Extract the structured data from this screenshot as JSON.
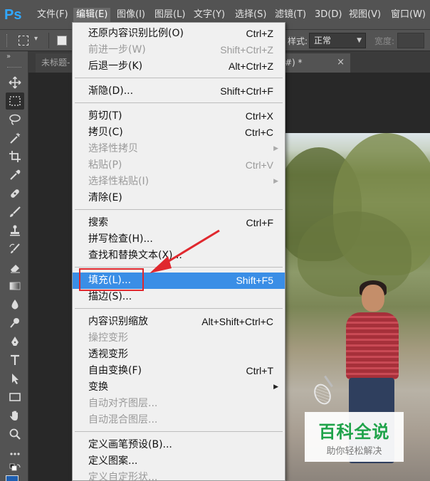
{
  "app": {
    "logo": "Ps"
  },
  "menubar": {
    "items": [
      {
        "label": "文件(F)"
      },
      {
        "label": "编辑(E)"
      },
      {
        "label": "图像(I)"
      },
      {
        "label": "图层(L)"
      },
      {
        "label": "文字(Y)"
      },
      {
        "label": "选择(S)"
      },
      {
        "label": "滤镜(T)"
      },
      {
        "label": "3D(D)"
      },
      {
        "label": "视图(V)"
      },
      {
        "label": "窗口(W)"
      }
    ]
  },
  "options": {
    "style_label": "样式:",
    "style_value": "正常",
    "width_label": "宽度:"
  },
  "tabs": {
    "inactive_label": "未标题-",
    "active_label": "#) *",
    "close": "×"
  },
  "edit_menu": {
    "items": [
      {
        "label": "还原内容识别比例(O)",
        "shortcut": "Ctrl+Z"
      },
      {
        "label": "前进一步(W)",
        "shortcut": "Shift+Ctrl+Z",
        "disabled": true
      },
      {
        "label": "后退一步(K)",
        "shortcut": "Alt+Ctrl+Z"
      },
      {
        "label": "渐隐(D)...",
        "shortcut": "Shift+Ctrl+F"
      },
      {
        "label": "剪切(T)",
        "shortcut": "Ctrl+X"
      },
      {
        "label": "拷贝(C)",
        "shortcut": "Ctrl+C"
      },
      {
        "label": "选择性拷贝",
        "shortcut": "",
        "disabled": true,
        "submenu": true
      },
      {
        "label": "粘贴(P)",
        "shortcut": "Ctrl+V",
        "disabled": true
      },
      {
        "label": "选择性粘贴(I)",
        "shortcut": "",
        "disabled": true,
        "submenu": true
      },
      {
        "label": "清除(E)",
        "shortcut": ""
      },
      {
        "label": "搜索",
        "shortcut": "Ctrl+F"
      },
      {
        "label": "拼写检查(H)...",
        "shortcut": ""
      },
      {
        "label": "查找和替换文本(X)...",
        "shortcut": ""
      },
      {
        "label": "填充(L)...",
        "shortcut": "Shift+F5",
        "highlighted": true
      },
      {
        "label": "描边(S)...",
        "shortcut": ""
      },
      {
        "label": "内容识别缩放",
        "shortcut": "Alt+Shift+Ctrl+C"
      },
      {
        "label": "操控变形",
        "shortcut": "",
        "disabled": true
      },
      {
        "label": "透视变形",
        "shortcut": ""
      },
      {
        "label": "自由变换(F)",
        "shortcut": "Ctrl+T"
      },
      {
        "label": "变换",
        "shortcut": "",
        "submenu": true
      },
      {
        "label": "自动对齐图层...",
        "shortcut": "",
        "disabled": true
      },
      {
        "label": "自动混合图层...",
        "shortcut": "",
        "disabled": true
      },
      {
        "label": "定义画笔预设(B)...",
        "shortcut": ""
      },
      {
        "label": "定义图案...",
        "shortcut": ""
      },
      {
        "label": "定义自定形状...",
        "shortcut": "",
        "disabled": true
      }
    ]
  },
  "watermark": {
    "title": "百科全说",
    "subtitle": "助你轻松解决"
  },
  "colors": {
    "highlight": "#3a8ee6",
    "annotation": "#e0282e",
    "watermark_green": "#1fa34a",
    "ps_blue": "#31a8ff"
  }
}
